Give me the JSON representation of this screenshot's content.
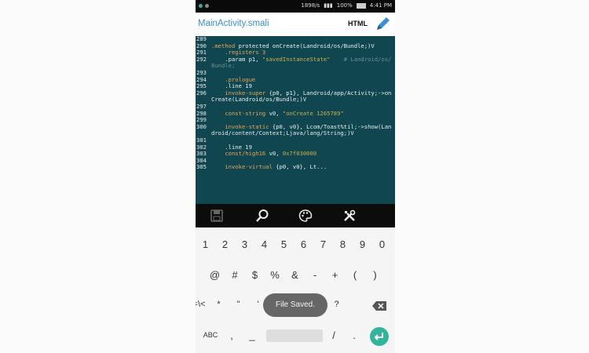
{
  "status_bar": {
    "network_speed": "1898/s",
    "battery": "100%",
    "time": "4:41 PM",
    "battery_level": 1.0
  },
  "app_bar": {
    "title": "MainActivity.smali",
    "html_label": "HTML",
    "edit_icon": "pencil-icon"
  },
  "editor": {
    "lines": [
      {
        "num": "289",
        "text": ""
      },
      {
        "num": "290",
        "parts": [
          {
            "t": ".method",
            "c": "c-kw"
          },
          {
            "t": " protected onCreate(Landroid/os/Bundle;)V"
          }
        ]
      },
      {
        "num": "291",
        "parts": [
          {
            "t": "    .registers 3",
            "c": "c-kw"
          }
        ]
      },
      {
        "num": "292",
        "parts": [
          {
            "t": "    .param p1, "
          },
          {
            "t": "\"savedInstanceState\"",
            "c": "c-str"
          },
          {
            "t": "    # Landroid/os/Bundle;",
            "c": "c-cm"
          }
        ]
      },
      {
        "num": "293",
        "text": ""
      },
      {
        "num": "294",
        "parts": [
          {
            "t": "    .prologue",
            "c": "c-kw"
          }
        ]
      },
      {
        "num": "295",
        "parts": [
          {
            "t": "    .line 19"
          }
        ]
      },
      {
        "num": "296",
        "parts": [
          {
            "t": "    invoke-super",
            "c": "c-kw"
          },
          {
            "t": " {p0, p1}, Landroid/app/Activity;->onCreate(Landroid/os/Bundle;)V"
          }
        ]
      },
      {
        "num": "297",
        "text": ""
      },
      {
        "num": "298",
        "parts": [
          {
            "t": "    const-string",
            "c": "c-kw"
          },
          {
            "t": " v0, "
          },
          {
            "t": "\"onCreate 1265789\"",
            "c": "c-str"
          }
        ]
      },
      {
        "num": "299",
        "text": ""
      },
      {
        "num": "300",
        "parts": [
          {
            "t": "    invoke-static",
            "c": "c-kw"
          },
          {
            "t": " {p0, v0}, Lcom/Toast%til;->show(Landroid/content/Context;Ljava/lang/String;)V"
          }
        ]
      },
      {
        "num": "301",
        "text": ""
      },
      {
        "num": "302",
        "parts": [
          {
            "t": "    .line 19"
          }
        ]
      },
      {
        "num": "303",
        "parts": [
          {
            "t": "    const/high16",
            "c": "c-kw"
          },
          {
            "t": " v0, "
          },
          {
            "t": "0x7f030000",
            "c": "c-str"
          }
        ]
      },
      {
        "num": "304",
        "text": ""
      },
      {
        "num": "305",
        "parts": [
          {
            "t": "    invoke-virtual",
            "c": "c-kw"
          },
          {
            "t": " {p0, v0}, Lt..."
          }
        ]
      }
    ]
  },
  "toolbar": {
    "icons": [
      "save-icon",
      "search-icon",
      "palette-icon",
      "tools-icon"
    ]
  },
  "keyboard": {
    "row1": [
      "1",
      "2",
      "3",
      "4",
      "5",
      "6",
      "7",
      "8",
      "9",
      "0"
    ],
    "row2": [
      "@",
      "#",
      "$",
      "%",
      "&",
      "-",
      "+",
      "(",
      ")"
    ],
    "row3": [
      "=\\<",
      "*",
      "\"",
      "'",
      ":",
      ";",
      "!",
      "?"
    ],
    "row4": {
      "abc": "ABC",
      "comma": ",",
      "underscore": "_",
      "slash": "/",
      "period": "."
    }
  },
  "toast": {
    "text": "File Saved."
  },
  "colors": {
    "accent_blue": "#3a8fd6",
    "editor_bg": "#0f4650",
    "enter_green": "#33b49d"
  }
}
